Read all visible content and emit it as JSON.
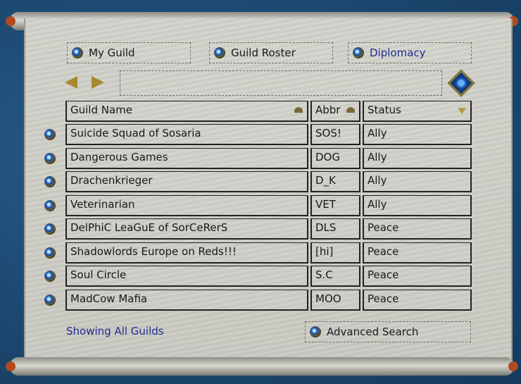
{
  "tabs": [
    {
      "label": "My Guild",
      "active": false
    },
    {
      "label": "Guild Roster",
      "active": false
    },
    {
      "label": "Diplomacy",
      "active": true
    }
  ],
  "tab_active_color": "#1f2d8f",
  "search": {
    "value": ""
  },
  "table": {
    "headers": {
      "name": "Guild Name",
      "abbr": "Abbr",
      "status": "Status"
    },
    "rows": [
      {
        "name": "Suicide Squad of Sosaria",
        "abbr": "SOS!",
        "status": "Ally"
      },
      {
        "name": "Dangerous Games",
        "abbr": "DOG",
        "status": "Ally"
      },
      {
        "name": "Drachenkrieger",
        "abbr": "D_K",
        "status": "Ally"
      },
      {
        "name": "Veterinarian",
        "abbr": "VET",
        "status": "Ally"
      },
      {
        "name": "DelPhiC LeaGuE of SorCeRerS",
        "abbr": "DLS",
        "status": "Peace"
      },
      {
        "name": "Shadowlords Europe on Reds!!!",
        "abbr": "[hi]",
        "status": "Peace"
      },
      {
        "name": "Soul Circle",
        "abbr": "S.C",
        "status": "Peace"
      },
      {
        "name": "MadCow Mafia",
        "abbr": "MOO",
        "status": "Peace"
      }
    ]
  },
  "footer": {
    "showing": "Showing All Guilds",
    "advanced_search": "Advanced Search"
  }
}
